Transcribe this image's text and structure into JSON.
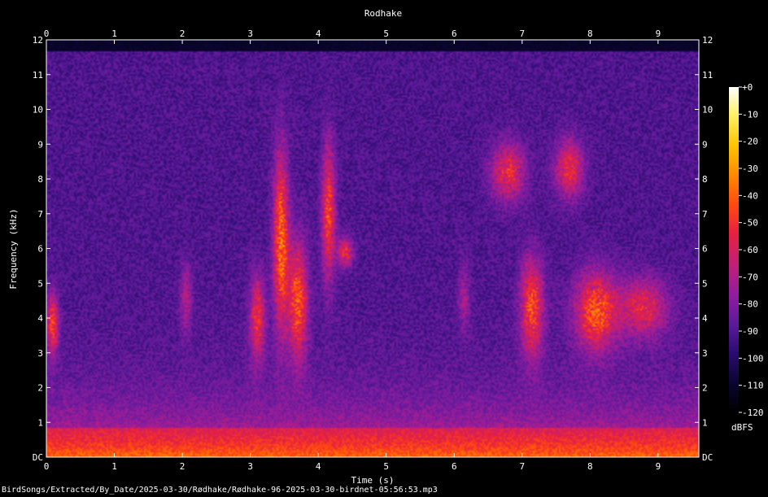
{
  "chart_data": {
    "type": "heatmap",
    "title": "Rodhake",
    "xlabel": "Time (s)",
    "ylabel": "Frequency (kHz)",
    "xlim": [
      0,
      9.6
    ],
    "ylim": [
      0,
      12
    ],
    "x_ticks": [
      "0",
      "1",
      "2",
      "3",
      "4",
      "5",
      "6",
      "7",
      "8",
      "9"
    ],
    "y_ticks": [
      "DC",
      "1",
      "2",
      "3",
      "4",
      "5",
      "6",
      "7",
      "8",
      "9",
      "10",
      "11",
      "12"
    ],
    "colorbar": {
      "label": "dBFS",
      "ticks": [
        "+0",
        "-10",
        "-20",
        "-30",
        "-40",
        "-50",
        "-60",
        "-70",
        "-80",
        "-90",
        "-100",
        "-110",
        "-120"
      ],
      "range": [
        -120,
        0
      ],
      "colors": [
        "#000000",
        "#0a0530",
        "#2a0b6e",
        "#5b1a9a",
        "#8f1d9e",
        "#c01f7a",
        "#e8203f",
        "#ff4a10",
        "#ff8a00",
        "#ffc400",
        "#ffef60",
        "#ffffff"
      ]
    },
    "grid": false
  },
  "footer": {
    "path": "BirdSongs/Extracted/By_Date/2025-03-30/Rødhake/Rødhake-96-2025-03-30-birdnet-05:56:53.mp3"
  }
}
